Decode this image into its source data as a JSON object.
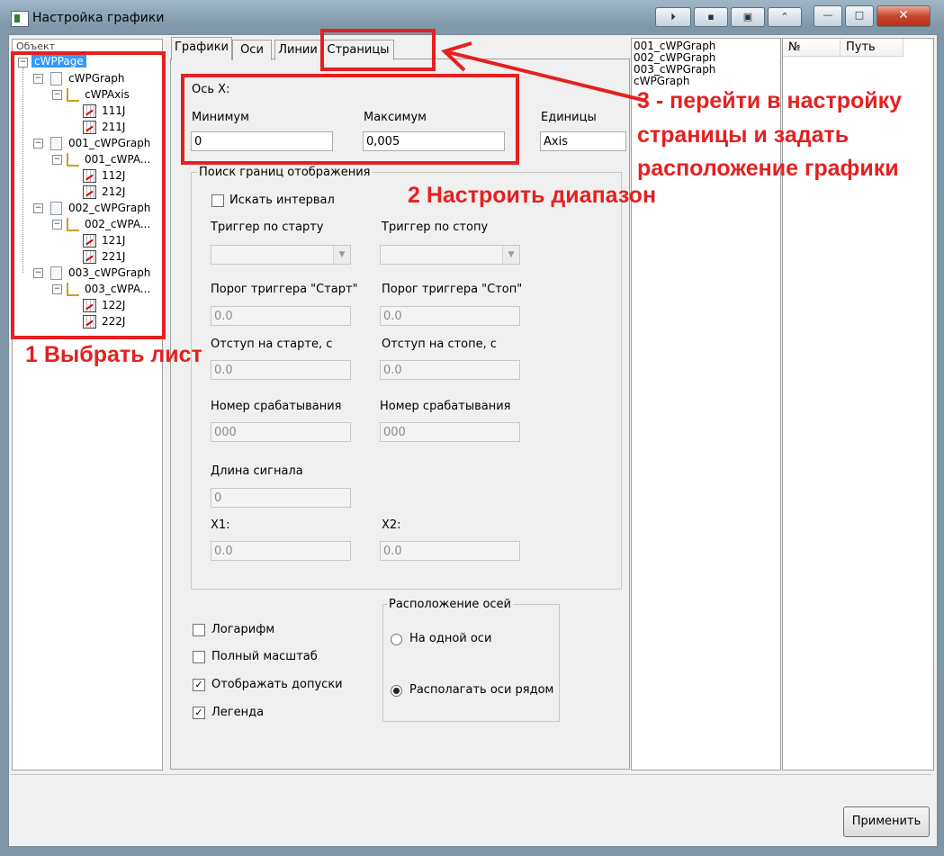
{
  "window": {
    "title": "Настройка графики",
    "controls": {
      "minimize": "—",
      "maximize": "□",
      "close": "✕"
    },
    "extra_buttons": [
      "⏵",
      "▪",
      "▣",
      "⌃"
    ]
  },
  "tree": {
    "header": "Объект",
    "root": "cWPPage",
    "graphs": [
      {
        "label": "cWPGraph",
        "axis": "cWPAxis",
        "lines": [
          "111J",
          "211J"
        ]
      },
      {
        "label": "001_cWPGraph",
        "axis": "001_cWPA...",
        "lines": [
          "112J",
          "212J"
        ]
      },
      {
        "label": "002_cWPGraph",
        "axis": "002_cWPA...",
        "lines": [
          "121J",
          "221J"
        ]
      },
      {
        "label": "003_cWPGraph",
        "axis": "003_cWPA...",
        "lines": [
          "122J",
          "222J"
        ]
      }
    ]
  },
  "tabs": [
    "Графики",
    "Оси",
    "Линии",
    "Страницы"
  ],
  "axis_x": {
    "title": "Ось X:",
    "min_label": "Минимум",
    "min_value": "0",
    "max_label": "Максимум",
    "max_value": "0,005",
    "units_label": "Единицы",
    "units_value": "Axis"
  },
  "bounds_search": {
    "title": "Поиск границ отображения",
    "search_interval": "Искать интервал",
    "trigger_start": "Триггер по старту",
    "trigger_stop": "Триггер по стопу",
    "threshold_start_label": "Порог триггера \"Старт\"",
    "threshold_start_value": "0.0",
    "threshold_stop_label": "Порог триггера \"Стоп\"",
    "threshold_stop_value": "0.0",
    "offset_start_label": "Отступ на старте, с",
    "offset_start_value": "0.0",
    "offset_stop_label": "Отступ на стопе, с",
    "offset_stop_value": "0.0",
    "fire_num_start_label": "Номер срабатывания",
    "fire_num_start_value": "000",
    "fire_num_stop_label": "Номер срабатывания",
    "fire_num_stop_value": "000",
    "signal_length_label": "Длина сигнала",
    "signal_length_value": "0",
    "x1_label": "X1:",
    "x1_value": "0.0",
    "x2_label": "X2:",
    "x2_value": "0.0"
  },
  "options": {
    "log": {
      "label": "Логарифм",
      "checked": false
    },
    "full_scale": {
      "label": "Полный масштаб",
      "checked": false
    },
    "show_tolerances": {
      "label": "Отображать допуски",
      "checked": true
    },
    "legend": {
      "label": "Легенда",
      "checked": true
    }
  },
  "axes_layout": {
    "title": "Расположение осей",
    "one_axis": "На одной оси",
    "side_by_side": "Располагать оси рядом",
    "selected": "side_by_side"
  },
  "graph_list": [
    "001_cWPGraph",
    "002_cWPGraph",
    "003_cWPGraph",
    "cWPGraph"
  ],
  "path_table": {
    "col_no": "№",
    "col_path": "Путь"
  },
  "apply_button": "Применить",
  "annotations": {
    "step1": "1 Выбрать лист",
    "step2": "2 Настроить диапазон",
    "step3_line1": "3 - перейти в настройку",
    "step3_line2": "страницы и задать",
    "step3_line3": "расположение графики"
  },
  "colors": {
    "annotation": "#e52020",
    "selection": "#3399ff",
    "close_button": "#c8432b"
  }
}
